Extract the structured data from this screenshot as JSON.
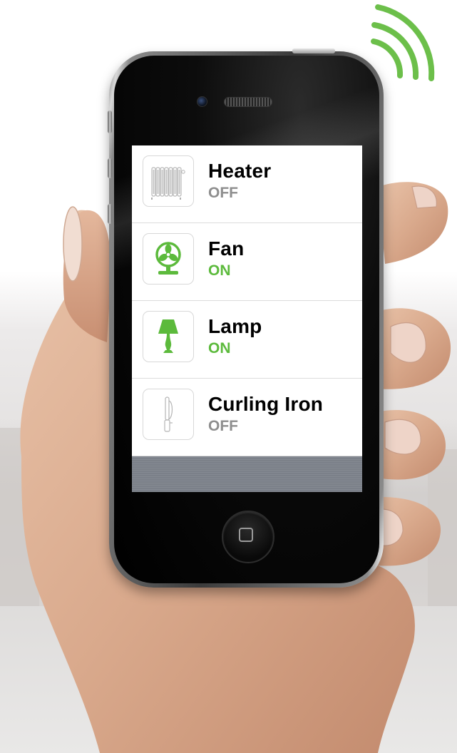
{
  "app": {
    "devices": [
      {
        "name": "Heater",
        "state": "OFF",
        "icon": "radiator-icon"
      },
      {
        "name": "Fan",
        "state": "ON",
        "icon": "fan-icon"
      },
      {
        "name": "Lamp",
        "state": "ON",
        "icon": "lamp-icon"
      },
      {
        "name": "Curling Iron",
        "state": "OFF",
        "icon": "curling-iron-icon"
      }
    ]
  },
  "colors": {
    "on": "#5cba3c",
    "off": "#8e8e8e",
    "wifi": "#6cbf4a"
  }
}
